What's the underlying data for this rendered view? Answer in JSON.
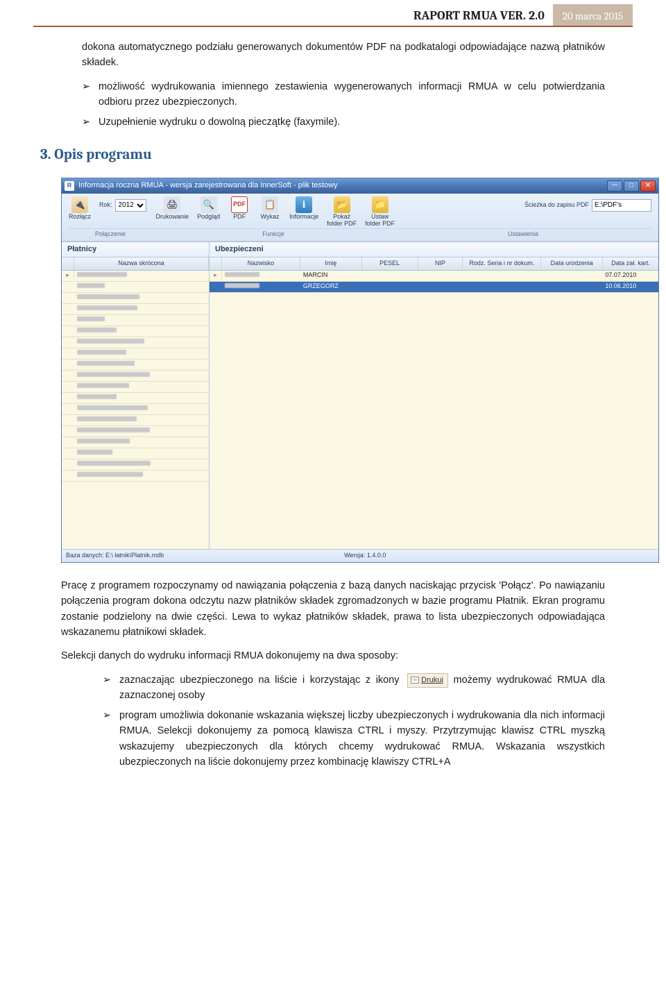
{
  "header": {
    "title": "RAPORT RMUA VER. 2.0",
    "date": "20 marca 2015"
  },
  "intro": {
    "p1": "dokona automatycznego podziału generowanych dokumentów PDF na podkatalogi odpowiadające nazwą płatników składek.",
    "li1": "możliwość wydrukowania imiennego zestawienia wygenerowanych informacji RMUA w celu potwierdzania odbioru przez ubezpieczonych.",
    "li2": "Uzupełnienie wydruku o dowolną pieczątkę (faxymile).",
    "h3": "3. Opis programu"
  },
  "screenshot": {
    "window_title": "Informacja roczna RMUA - wersja zarejestrowana dla InnerSoft - plik testowy",
    "ribbon": {
      "rok_label": "Rok:",
      "rok_value": "2012",
      "buttons": {
        "rozlacz": "Rozłącz",
        "drukowanie": "Drukowanie",
        "podglad": "Podgląd",
        "pdf": "PDF",
        "wykaz": "Wykaz",
        "informacje": "Informacje",
        "pokaz_folder": "Pokaż\nfolder PDF",
        "ustaw_folder": "Ustaw\nfolder PDF"
      },
      "path_label": "Ścieżka do zapisu PDF",
      "path_value": "E:\\PDF's",
      "groups": {
        "g1": "Połączenie",
        "g2": "Funkcje",
        "g3": "Ustawienia"
      }
    },
    "panels": {
      "left": "Płatnicy",
      "right": "Ubezpieczeni"
    },
    "left_cols": {
      "idx": "",
      "name": "Nazwa skrócona"
    },
    "right_cols": {
      "c2": "Nazwisko",
      "c3": "Imię",
      "c4": "PESEL",
      "c5": "NIP",
      "c6": "Rodz. Seria i nr dokum.",
      "c7": "Data urodzenia",
      "c8": "Data zał. kart."
    },
    "right_rows": [
      {
        "imie": "MARCIN",
        "data_zal": "07.07.2010"
      },
      {
        "imie": "GRZEGORZ",
        "data_zal": "10.06.2010"
      }
    ],
    "left_row_count": 19,
    "statusbar": {
      "left": "Baza danych: E:\\        łatnik\\Platnik.mdb",
      "right": "Wersja: 1.4.0.0"
    }
  },
  "body": {
    "p1": "Pracę z programem rozpoczynamy od nawiązania połączenia z bazą danych naciskając przycisk 'Połącz'.  Po nawiązaniu połączenia program dokona odczytu nazw płatników składek zgromadzonych w bazie programu Płatnik. Ekran programu zostanie podzielony na dwie części. Lewa to wykaz płatników składek, prawa to lista ubezpieczonych odpowiadająca wskazanemu płatnikowi składek.",
    "p2": "Selekcji danych do wydruku informacji RMUA dokonujemy na dwa sposoby:",
    "li1a": "zaznaczając ubezpieczonego na liście i korzystając z ikony",
    "li1b": "możemy wydrukować RMUA dla zaznaczonej osoby",
    "drukuj_label": "Drukuj",
    "li2": "program umożliwia dokonanie wskazania większej liczby ubezpieczonych i wydrukowania dla nich informacji RMUA. Selekcji dokonujemy za pomocą klawisza CTRL i myszy. Przytrzymując klawisz CTRL myszką wskazujemy ubezpieczonych dla których chcemy wydrukować RMUA. Wskazania wszystkich ubezpieczonych na liście dokonujemy przez kombinację klawiszy CTRL+A"
  }
}
